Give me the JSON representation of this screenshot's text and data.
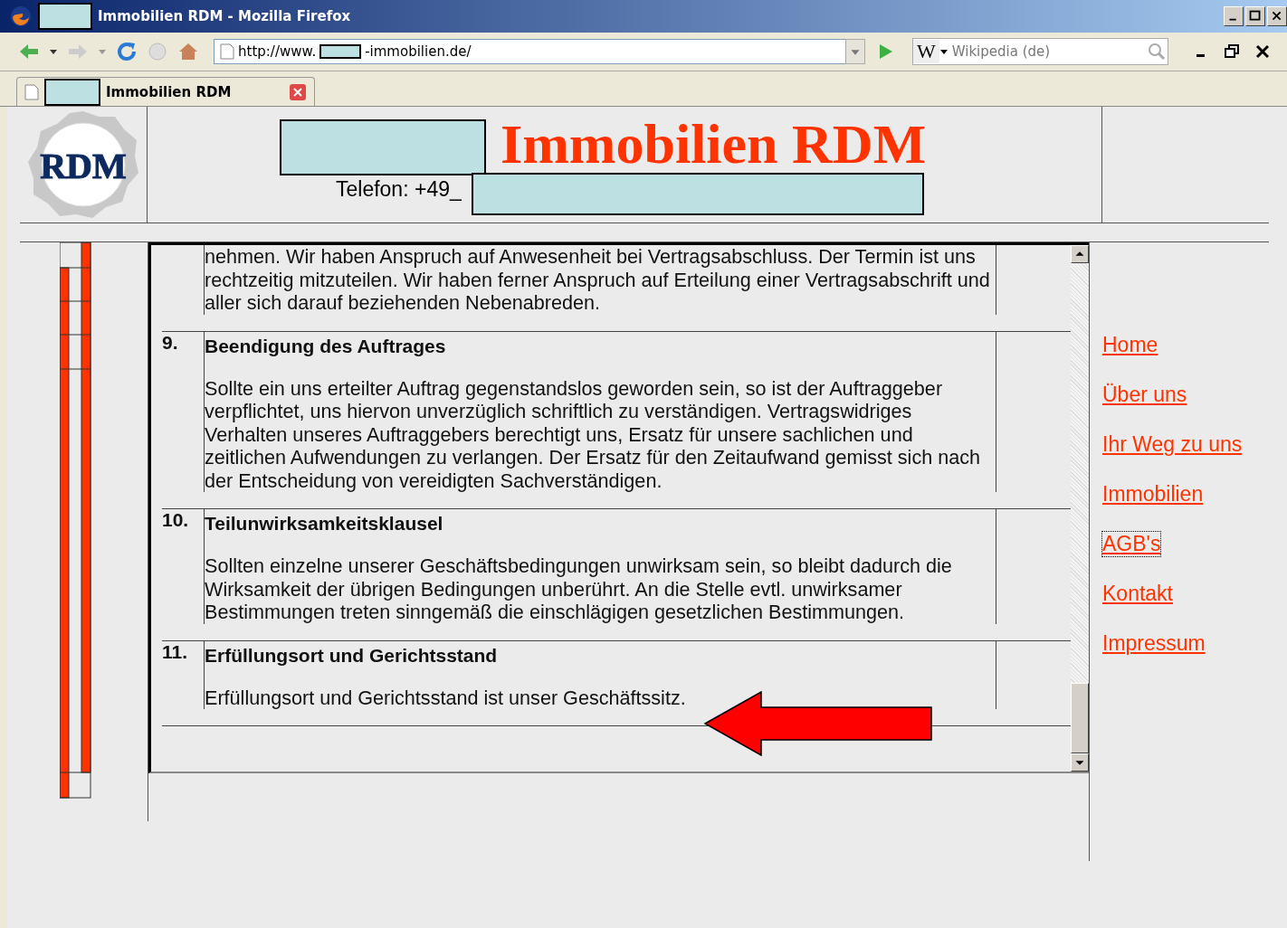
{
  "window": {
    "title": "Immobilien RDM - Mozilla Firefox"
  },
  "toolbar": {
    "url_prefix": "http://www.",
    "url_suffix": "-immobilien.de/",
    "search_engine": "W",
    "search_placeholder": "Wikipedia (de)"
  },
  "tabs": [
    {
      "label": "Immobilien RDM",
      "selected": true
    }
  ],
  "page": {
    "logo": "RDM",
    "title": "Immobilien RDM",
    "phone": "Telefon: +49_",
    "sections": [
      {
        "paragraph": "nehmen. Wir haben Anspruch auf Anwesenheit bei Vertragsabschluss. Der Termin ist uns rechtzeitig mitzuteilen. Wir haben ferner Anspruch auf Erteilung einer Vertragsabschrift und aller sich darauf beziehenden Nebenabreden."
      },
      {
        "number": "9.",
        "heading": "Beendigung des Auftrages",
        "paragraph": "Sollte ein uns erteilter Auftrag gegenstandslos geworden sein, so ist der Auftraggeber verpflichtet, uns hiervon unverzüglich schriftlich zu verständigen. Vertragswidriges Verhalten unseres Auftraggebers berechtigt uns, Ersatz für unsere sachlichen und zeitlichen Aufwendungen zu verlangen. Der Ersatz für den Zeitaufwand gemisst sich nach der Entscheidung von vereidigten Sachverständigen."
      },
      {
        "number": "10.",
        "heading": "Teilunwirksamkeitsklausel",
        "paragraph": "Sollten einzelne unserer Geschäftsbedingungen unwirksam sein, so bleibt dadurch die Wirksamkeit der übrigen Bedingungen unberührt. An die Stelle evtl. unwirksamer Bestimmungen treten sinngemäß die einschlägigen gesetzlichen Bestimmungen."
      },
      {
        "number": "11.",
        "heading": "Erfüllungsort und Gerichtsstand",
        "paragraph": "Erfüllungsort und Gerichtsstand ist unser Geschäftssitz."
      }
    ],
    "nav": [
      {
        "label": "Home",
        "focused": false
      },
      {
        "label": "Über uns",
        "focused": false
      },
      {
        "label": "Ihr Weg zu uns",
        "focused": false
      },
      {
        "label": "Immobilien",
        "focused": false
      },
      {
        "label": "AGB's",
        "focused": true
      },
      {
        "label": "Kontakt",
        "focused": false
      },
      {
        "label": "Impressum",
        "focused": false
      }
    ]
  }
}
